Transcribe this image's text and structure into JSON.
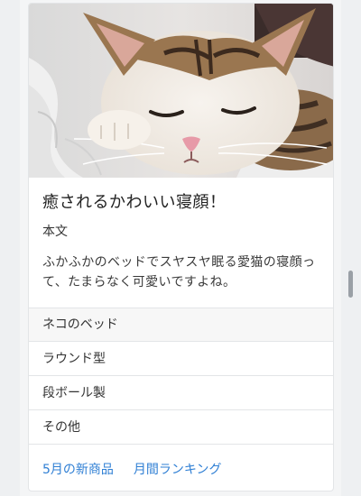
{
  "card": {
    "image_alt": "寝ている猫",
    "title": "癒されるかわいい寝顔！",
    "subtitle": "本文",
    "text": "ふかふかのベッドでスヤスヤ眠る愛猫の寝顔って、たまらなく可愛いですよね。"
  },
  "list": {
    "header": "ネコのベッド",
    "items": [
      "ラウンド型",
      "段ボール製",
      "その他"
    ]
  },
  "links": [
    "5月の新商品",
    "月間ランキング"
  ],
  "colors": {
    "link": "#2f7fd4",
    "list_header_bg": "#f7f7f7",
    "border": "#e3e5e7"
  }
}
